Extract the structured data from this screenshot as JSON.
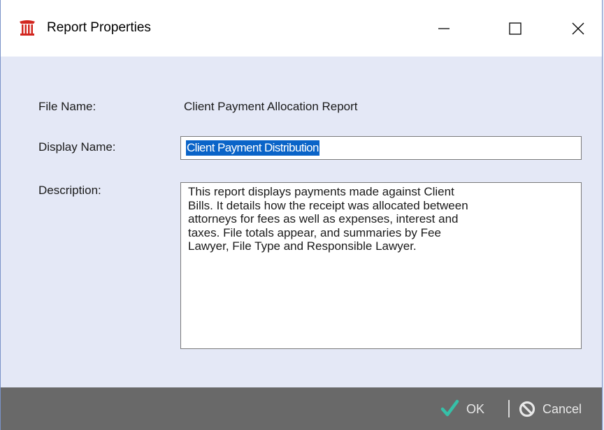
{
  "window": {
    "title": "Report Properties",
    "app_icon": "courthouse-icon",
    "minimize_icon": "minimize-icon",
    "maximize_icon": "maximize-icon",
    "close_icon": "close-icon"
  },
  "form": {
    "file_name_label": "File Name:",
    "file_name_value": "Client Payment Allocation Report",
    "display_name_label": "Display Name:",
    "display_name_value": "Client Payment Distribution",
    "description_label": "Description:",
    "description_value": "This report displays payments made against Client\nBills. It details how the receipt was allocated between\nattorneys for fees as well as expenses, interest and\ntaxes. File totals appear, and summaries by Fee\nLawyer, File Type and Responsible Lawyer."
  },
  "footer": {
    "ok_label": "OK",
    "ok_icon": "checkmark-icon",
    "cancel_label": "Cancel",
    "cancel_icon": "prohibited-icon"
  },
  "colors": {
    "background": "#e4e8f6",
    "footer": "#696969",
    "ok_check": "#36c0a8",
    "app_icon": "#d2261f",
    "selection": "#0a64c8"
  }
}
